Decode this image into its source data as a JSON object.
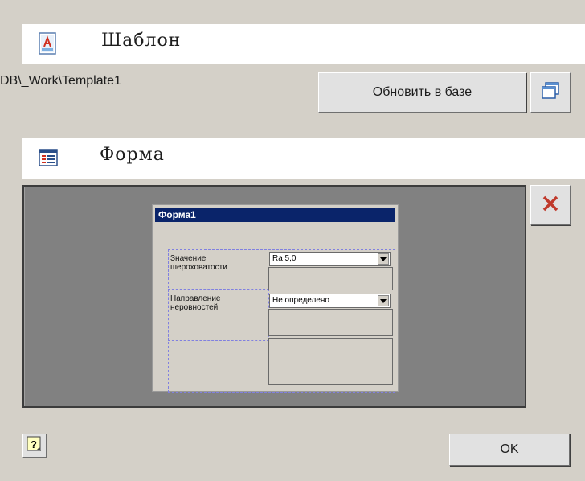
{
  "template_section": {
    "title": "Шаблон",
    "icon": "template-document-icon",
    "path": "DB\\_Work\\Template1",
    "update_button_label": "Обновить в базе",
    "browse_icon": "browse-windows-icon"
  },
  "form_section": {
    "title": "Форма",
    "icon": "form-layout-icon",
    "delete_icon": "delete-x-icon",
    "preview": {
      "window_title": "Форма1",
      "fields": [
        {
          "label": "Значение шероховатости",
          "value": "Ra 5,0"
        },
        {
          "label": "Направление неровностей",
          "value": "Не определено"
        }
      ]
    }
  },
  "footer": {
    "help_icon": "help-question-icon",
    "ok_label": "OK"
  },
  "colors": {
    "background": "#d4d0c8",
    "header_bg": "#ffffff",
    "preview_bg": "#818181",
    "titlebar": "#0a246a",
    "delete_red": "#c0392b"
  }
}
